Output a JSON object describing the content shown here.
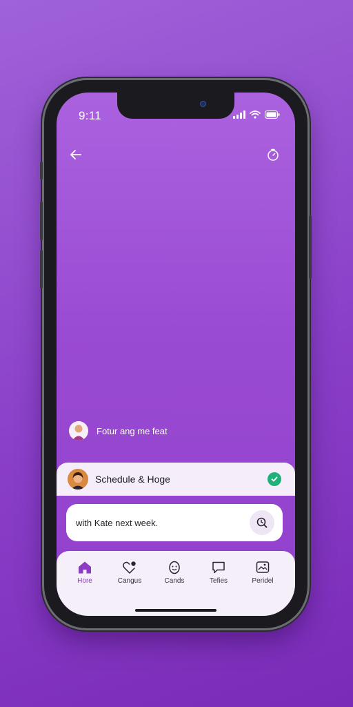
{
  "status_bar": {
    "time": "9:11"
  },
  "header": {
    "back_icon": "arrow-left-icon",
    "timer_icon": "timer-icon"
  },
  "message": {
    "text": "Fotur ang me feat"
  },
  "schedule_card": {
    "title": "Schedule & Hoge",
    "status_icon": "check-circle-icon",
    "status_color": "#22b07a"
  },
  "input": {
    "value": "with Kate next week.",
    "action_icon": "search-clock-icon"
  },
  "tabbar": {
    "items": [
      {
        "label": "Hore",
        "icon": "home-icon",
        "active": true
      },
      {
        "label": "Cangus",
        "icon": "heart-notification-icon",
        "active": false
      },
      {
        "label": "Cands",
        "icon": "face-icon",
        "active": false
      },
      {
        "label": "Tefies",
        "icon": "chat-bubble-icon",
        "active": false
      },
      {
        "label": "Peridel",
        "icon": "gallery-icon",
        "active": false
      }
    ]
  },
  "colors": {
    "accent": "#8d3bc4",
    "background_top": "#a062d8",
    "background_bottom": "#7a2bb8"
  }
}
